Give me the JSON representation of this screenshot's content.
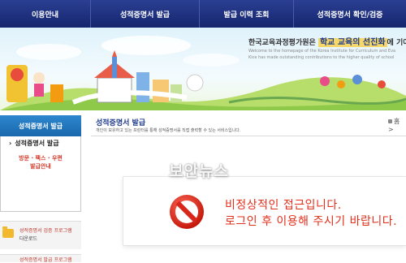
{
  "nav": {
    "items": [
      {
        "label": "이용안내"
      },
      {
        "label": "성적증명서 발급"
      },
      {
        "label": "발급 이력 조회"
      },
      {
        "label": "성적증명서 확인/검증"
      }
    ]
  },
  "banner": {
    "title_prefix": "한국교육과정평가원은",
    "title_highlight": "학교 교육의 선진화",
    "title_suffix": "에 기여",
    "sub1": "Welcome to the homepage of the Korea Institute for Curriculum and Eva",
    "sub2": "Kice has made outstanding contributions to the higher quality of school"
  },
  "sidebar": {
    "header": "성적증명서 발급",
    "item": "성적증명서 발급",
    "sub1": "방문 · 팩스 · 우편",
    "sub2": "발급안내",
    "link1_line1": "성적증명서 검증 프로그램",
    "link1_line2": "다운로드",
    "link2_line1": "성적증명서 발급 프로그램"
  },
  "main": {
    "title": "성적증명서 발급",
    "description": "개인이 보유하고 있는 프린터를 통해 성적증명서를 직접 출력할 수 있는 서비스입니다.",
    "home": "홈 >"
  },
  "error": {
    "line1": "비정상적인 접근입니다.",
    "line2": "로그인 후 이용해 주시기 바랍니다."
  },
  "watermark": "보안뉴스",
  "colors": {
    "nav_bg": "#1c2e80",
    "side_header": "#1f73b9",
    "title_blue": "#1f3b8a",
    "error_red": "#e0301c"
  }
}
